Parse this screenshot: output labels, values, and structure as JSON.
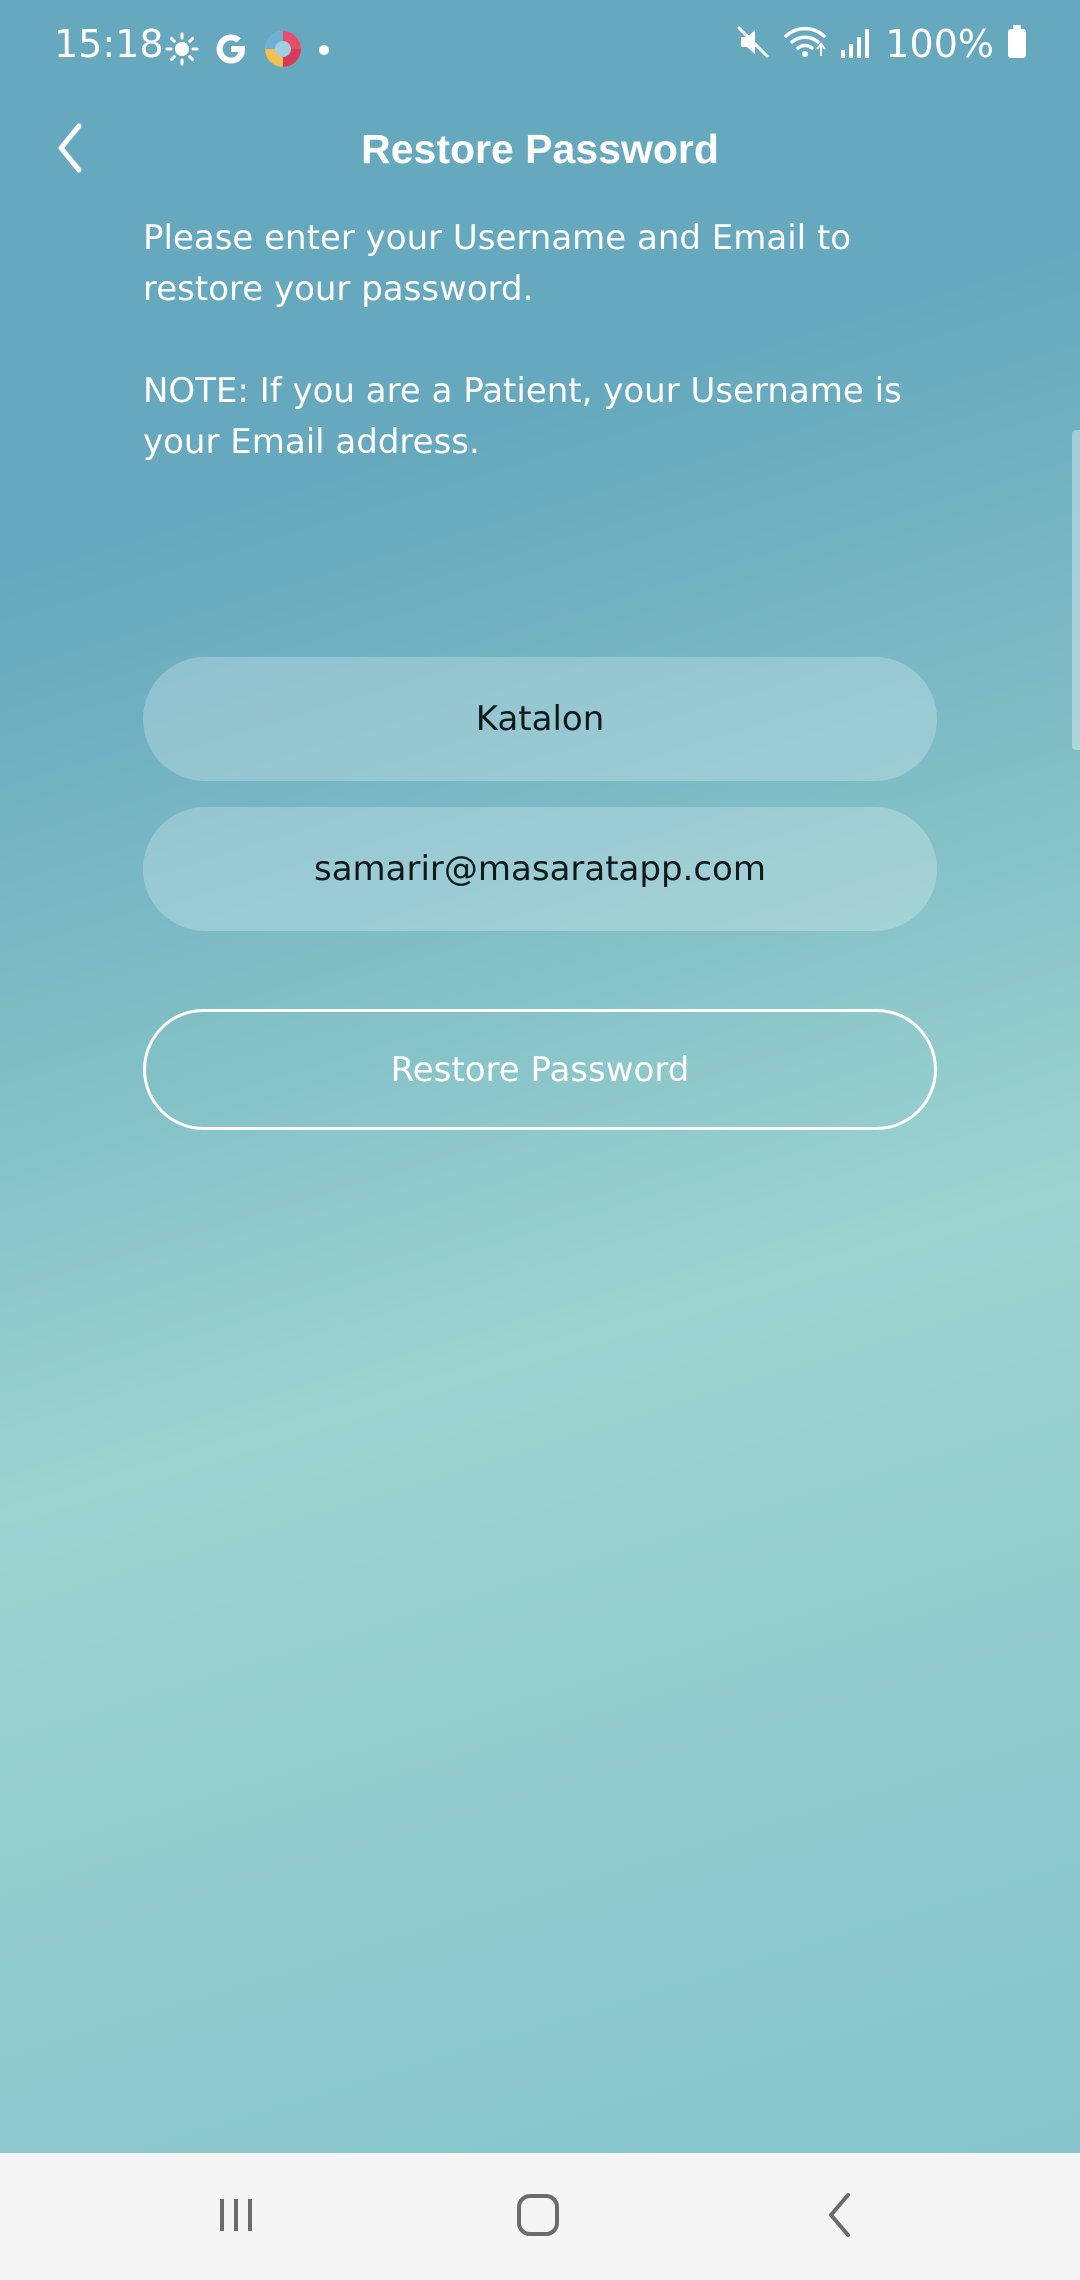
{
  "status_bar": {
    "time": "15:18",
    "battery": "100%",
    "left_icons": [
      "brightness-icon",
      "google-icon",
      "app-notification-icon",
      "more-dot-icon"
    ],
    "right_icons": [
      "mute-icon",
      "wifi-icon",
      "signal-icon",
      "battery-icon"
    ]
  },
  "header": {
    "title": "Restore Password",
    "back_icon": "chevron-left-icon"
  },
  "instructions": {
    "line1": "Please enter your Username and Email to restore your password.",
    "line2": "NOTE: If you are a Patient, your Username is your Email address."
  },
  "form": {
    "username_value": "Katalon",
    "email_value": "samarir@masaratapp.com",
    "submit_label": "Restore Password"
  },
  "nav_bar": {
    "buttons": [
      "recents-icon",
      "home-icon",
      "back-icon"
    ]
  },
  "colors": {
    "background_top": "#66a9be",
    "background_mid": "#9dd3d1",
    "nav_bar": "#f5f5f5",
    "field_text": "#0f1a1c"
  }
}
